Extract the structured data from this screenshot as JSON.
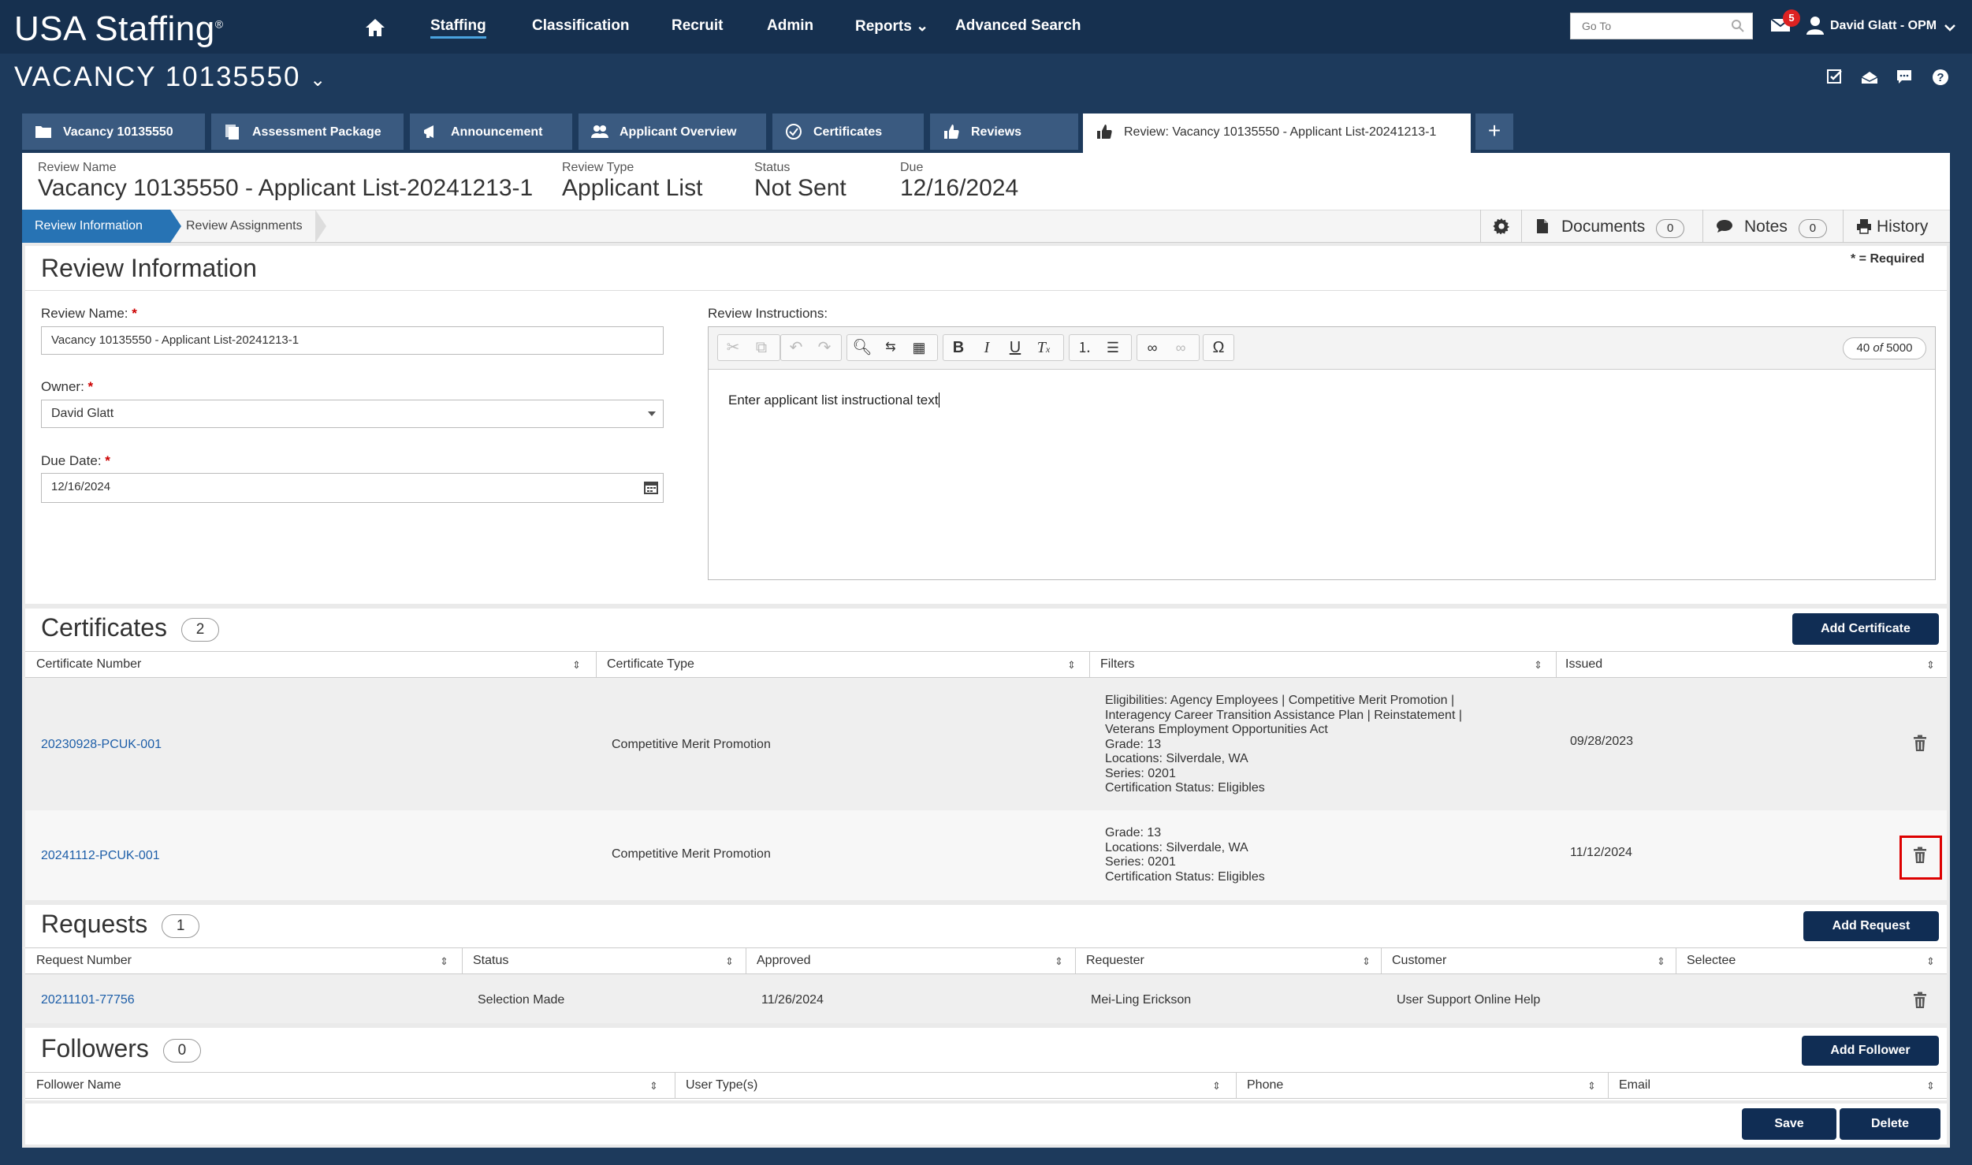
{
  "nav": {
    "logo": "USA Staffing",
    "logo_mark": "®",
    "links": [
      "Staffing",
      "Classification",
      "Recruit",
      "Admin",
      "Reports",
      "Advanced Search"
    ],
    "reports_chevron": "⌄",
    "goto_placeholder": "Go To",
    "mail_count": "5",
    "user_name": "David Glatt - OPM"
  },
  "vacancy": {
    "title": "VACANCY 10135550",
    "chevron": "⌄"
  },
  "tabs": [
    {
      "label": "Vacancy 10135550"
    },
    {
      "label": "Assessment Package"
    },
    {
      "label": "Announcement"
    },
    {
      "label": "Applicant Overview"
    },
    {
      "label": "Certificates"
    },
    {
      "label": "Reviews"
    },
    {
      "label": "Review: Vacancy 10135550 - Applicant List-20241213-1"
    }
  ],
  "tab_add": "+",
  "summary": {
    "review_name_label": "Review Name",
    "review_name": "Vacancy 10135550 - Applicant List-20241213-1",
    "review_type_label": "Review Type",
    "review_type": "Applicant List",
    "status_label": "Status",
    "status": "Not Sent",
    "due_label": "Due",
    "due": "12/16/2024"
  },
  "subnav": {
    "active": "Review Information",
    "item": "Review Assignments",
    "documents_label": "Documents",
    "documents_count": "0",
    "notes_label": "Notes",
    "notes_count": "0",
    "history_label": "History"
  },
  "review_info": {
    "title": "Review Information",
    "required_note": "* = Required",
    "name_label": "Review Name:",
    "name_value": "Vacancy 10135550 - Applicant List-20241213-1",
    "owner_label": "Owner:",
    "owner_value": "David Glatt",
    "due_label": "Due Date:",
    "due_value": "12/16/2024",
    "instructions_label": "Review Instructions:",
    "instructions_text": "Enter applicant list instructional text",
    "char_count": "40",
    "char_of": "of",
    "char_max": "5000",
    "required_star": "*"
  },
  "certificates": {
    "title": "Certificates",
    "count": "2",
    "add_button": "Add Certificate",
    "headers": [
      "Certificate Number",
      "Certificate Type",
      "Filters",
      "Issued"
    ],
    "rows": [
      {
        "number": "20230928-PCUK-001",
        "type": "Competitive Merit Promotion",
        "filters": [
          "Eligibilities: Agency Employees | Competitive Merit Promotion |",
          "Interagency Career Transition Assistance Plan | Reinstatement |",
          "Veterans Employment Opportunities Act",
          "Grade: 13",
          "Locations: Silverdale, WA",
          "Series: 0201",
          "Certification Status: Eligibles"
        ],
        "issued": "09/28/2023"
      },
      {
        "number": "20241112-PCUK-001",
        "type": "Competitive Merit Promotion",
        "filters": [
          "Grade: 13",
          "Locations: Silverdale, WA",
          "Series: 0201",
          "Certification Status: Eligibles"
        ],
        "issued": "11/12/2024"
      }
    ]
  },
  "requests": {
    "title": "Requests",
    "count": "1",
    "add_button": "Add Request",
    "headers": [
      "Request Number",
      "Status",
      "Approved",
      "Requester",
      "Customer",
      "Selectee"
    ],
    "rows": [
      {
        "number": "20211101-77756",
        "status": "Selection Made",
        "approved": "11/26/2024",
        "requester": "Mei-Ling Erickson",
        "customer": "User Support Online Help",
        "selectee": ""
      }
    ]
  },
  "followers": {
    "title": "Followers",
    "count": "0",
    "add_button": "Add Follower",
    "headers": [
      "Follower Name",
      "User Type(s)",
      "Phone",
      "Email"
    ]
  },
  "footer": {
    "save": "Save",
    "delete": "Delete"
  },
  "sort_glyph": "⇕",
  "colors": {
    "nav_bg": "#16304f",
    "tab_bg": "#3a5a80",
    "active_blue": "#2773b4",
    "button_dark": "#102d54",
    "highlight": "#d00000"
  }
}
